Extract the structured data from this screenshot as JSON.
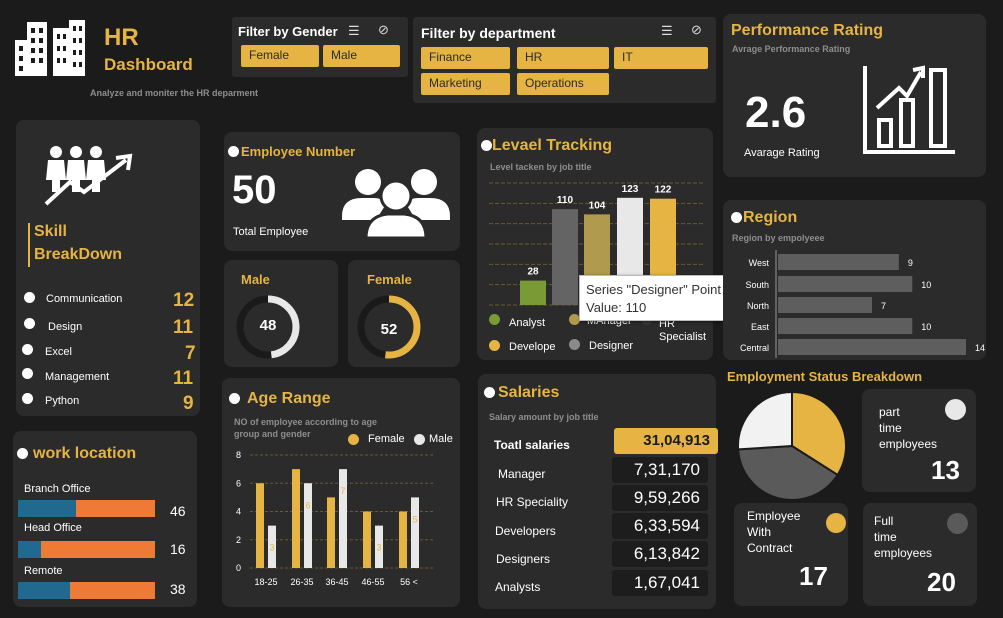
{
  "header": {
    "title": "HR",
    "subtitle": "Dashboard",
    "tagline": "Analyze and moniter the HR deparment"
  },
  "filters": {
    "gender": {
      "title": "Filter by Gender",
      "options": [
        "Female",
        "Male"
      ]
    },
    "department": {
      "title": "Filter by department",
      "options": [
        "Finance",
        "HR",
        "IT",
        "Marketing",
        "Operations"
      ]
    }
  },
  "performance": {
    "title": "Performance Rating",
    "subtitle": "Avrage Performance Rating",
    "value": "2.6",
    "label": "Avarage Rating"
  },
  "skills": {
    "title_line1": "Skill",
    "title_line2": "BreakDown",
    "items": [
      {
        "name": "Communication",
        "value": "12"
      },
      {
        "name": "Design",
        "value": "11"
      },
      {
        "name": "Excel",
        "value": "7"
      },
      {
        "name": "Management",
        "value": "11"
      },
      {
        "name": "Python",
        "value": "9"
      }
    ]
  },
  "employee_number": {
    "title": "Employee Number",
    "value": "50",
    "label": "Total Employee"
  },
  "male": {
    "title": "Male",
    "value": "48",
    "fraction": 0.48
  },
  "female": {
    "title": "Female",
    "value": "52",
    "fraction": 0.52
  },
  "level_tracking": {
    "title": "Levael Tracking",
    "subtitle": "Level tacken by job title",
    "legend": [
      "Analyst",
      "MAnager",
      "HR Specialist",
      "Develope",
      "Designer"
    ],
    "tooltip": {
      "line1": "Series \"Designer\" Point 1",
      "line2": "Value:  110"
    }
  },
  "region": {
    "title": "Region",
    "subtitle": "Region by empolyeee"
  },
  "work_location": {
    "title": "work location",
    "items": [
      {
        "name": "Branch Office",
        "value": "46",
        "fraction": 0.42
      },
      {
        "name": "Head Office",
        "value": "16",
        "fraction": 0.17
      },
      {
        "name": "Remote",
        "value": "38",
        "fraction": 0.38
      }
    ]
  },
  "age_range": {
    "title": "Age Range",
    "subtitle_line1": "NO of employee according to age",
    "subtitle_line2": "group and gender",
    "legend": [
      "Female",
      "Male"
    ]
  },
  "salaries": {
    "title": "Salaries",
    "subtitle": "Salary amount by job title",
    "rows": [
      {
        "label": "Toatl salaries",
        "value": "31,04,913"
      },
      {
        "label": "Manager",
        "value": "7,31,170"
      },
      {
        "label": "HR Speciality",
        "value": "9,59,266"
      },
      {
        "label": "Developers",
        "value": "6,33,594"
      },
      {
        "label": "Designers",
        "value": "6,13,842"
      },
      {
        "label": "Analysts",
        "value": "1,67,041"
      }
    ]
  },
  "employment": {
    "title": "Employment Status Breakdown",
    "part_time": {
      "line1": "part",
      "line2": "time",
      "line3": "employees",
      "value": "13"
    },
    "contract": {
      "line1": "Employee",
      "line2": "With",
      "line3": "Contract",
      "value": "17"
    },
    "full_time": {
      "line1": "Full",
      "line2": "time",
      "line3": "employees",
      "value": "20"
    }
  },
  "colors": {
    "accent": "#e5b443",
    "panel": "#2b2b2b",
    "background": "#1b1b1b",
    "orange": "#ee7a35",
    "blue": "#21698f"
  },
  "chart_data": [
    {
      "type": "bar",
      "categories": [
        "Analyst",
        "Designer",
        "Develope",
        "HR Specialist",
        "MAnager"
      ],
      "values": [
        28,
        110,
        104,
        123,
        122
      ],
      "colors": [
        "#7a9a36",
        "#646464",
        "#b09a4e",
        "#e8e8e8",
        "#e5b443"
      ],
      "ylim": [
        0,
        140
      ]
    },
    {
      "type": "bar",
      "categories": [
        "West",
        "South",
        "North",
        "East",
        "Central"
      ],
      "values": [
        9,
        10,
        7,
        10,
        14
      ],
      "orientation": "horizontal",
      "xlim": [
        0,
        14
      ]
    },
    {
      "type": "bar",
      "categories": [
        "18-25",
        "26-35",
        "36-45",
        "46-55",
        "56 <"
      ],
      "series": [
        {
          "name": "Female",
          "values": [
            6,
            7,
            5,
            4,
            4
          ]
        },
        {
          "name": "Male",
          "values": [
            3,
            6,
            7,
            3,
            5
          ]
        }
      ],
      "ylim": [
        0,
        8
      ],
      "yticks": [
        0,
        2,
        4,
        6,
        8
      ],
      "grid": true,
      "legend": "top-right"
    },
    {
      "type": "pie",
      "categories": [
        "part time employees",
        "Employee With Contract",
        "Full time employees"
      ],
      "values": [
        13,
        17,
        20
      ]
    }
  ]
}
